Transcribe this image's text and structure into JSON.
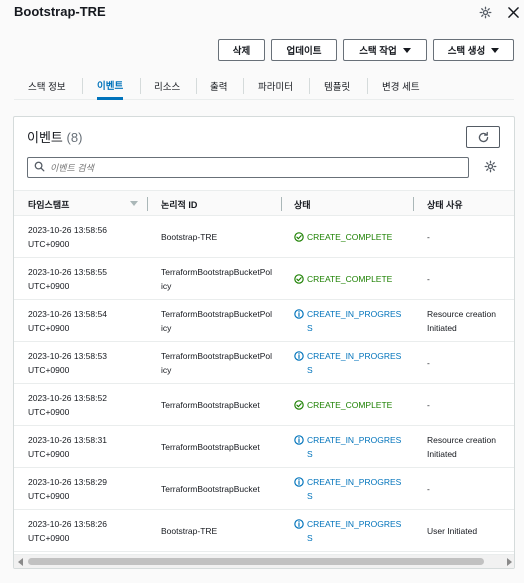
{
  "header": {
    "stack_name": "Bootstrap-TRE",
    "settings_icon": "gear-icon",
    "close_icon": "close-icon"
  },
  "actions": {
    "delete": "삭제",
    "update": "업데이트",
    "stack_actions": "스택 작업",
    "create_stack": "스택 생성"
  },
  "tabs": [
    {
      "label": "스택 정보",
      "active": false
    },
    {
      "label": "이벤트",
      "active": true
    },
    {
      "label": "리소스",
      "active": false
    },
    {
      "label": "출력",
      "active": false
    },
    {
      "label": "파라미터",
      "active": false
    },
    {
      "label": "템플릿",
      "active": false
    },
    {
      "label": "변경 세트",
      "active": false
    }
  ],
  "events": {
    "title": "이벤트",
    "count": "(8)",
    "search_placeholder": "이벤트 검색",
    "columns": {
      "timestamp": "타임스탬프",
      "logical_id": "논리적 ID",
      "status": "상태",
      "reason": "상태 사유"
    },
    "rows": [
      {
        "time": "2023-10-26 13:58:56",
        "tz": "UTC+0900",
        "lid": "Bootstrap-TRE",
        "status1": "CREATE_COMPLETE",
        "status2": "",
        "kind": "complete",
        "reason1": "-",
        "reason2": ""
      },
      {
        "time": "2023-10-26 13:58:55",
        "tz": "UTC+0900",
        "lid": "TerraformBootstrapBucketPolicy",
        "status1": "CREATE_COMPLETE",
        "status2": "",
        "kind": "complete",
        "reason1": "-",
        "reason2": ""
      },
      {
        "time": "2023-10-26 13:58:54",
        "tz": "UTC+0900",
        "lid": "TerraformBootstrapBucketPolicy",
        "status1": "CREATE_IN_PROGRES",
        "status2": "S",
        "kind": "progress",
        "reason1": "Resource creation",
        "reason2": "Initiated"
      },
      {
        "time": "2023-10-26 13:58:53",
        "tz": "UTC+0900",
        "lid": "TerraformBootstrapBucketPolicy",
        "status1": "CREATE_IN_PROGRES",
        "status2": "S",
        "kind": "progress",
        "reason1": "-",
        "reason2": ""
      },
      {
        "time": "2023-10-26 13:58:52",
        "tz": "UTC+0900",
        "lid": "TerraformBootstrapBucket",
        "status1": "CREATE_COMPLETE",
        "status2": "",
        "kind": "complete",
        "reason1": "-",
        "reason2": ""
      },
      {
        "time": "2023-10-26 13:58:31",
        "tz": "UTC+0900",
        "lid": "TerraformBootstrapBucket",
        "status1": "CREATE_IN_PROGRES",
        "status2": "S",
        "kind": "progress",
        "reason1": "Resource creation",
        "reason2": "Initiated"
      },
      {
        "time": "2023-10-26 13:58:29",
        "tz": "UTC+0900",
        "lid": "TerraformBootstrapBucket",
        "status1": "CREATE_IN_PROGRES",
        "status2": "S",
        "kind": "progress",
        "reason1": "-",
        "reason2": ""
      },
      {
        "time": "2023-10-26 13:58:26",
        "tz": "UTC+0900",
        "lid": "Bootstrap-TRE",
        "status1": "CREATE_IN_PROGRES",
        "status2": "S",
        "kind": "progress",
        "reason1": "User Initiated",
        "reason2": ""
      }
    ]
  },
  "colors": {
    "accent": "#0073bb",
    "success": "#1d8102",
    "text": "#16191f"
  }
}
